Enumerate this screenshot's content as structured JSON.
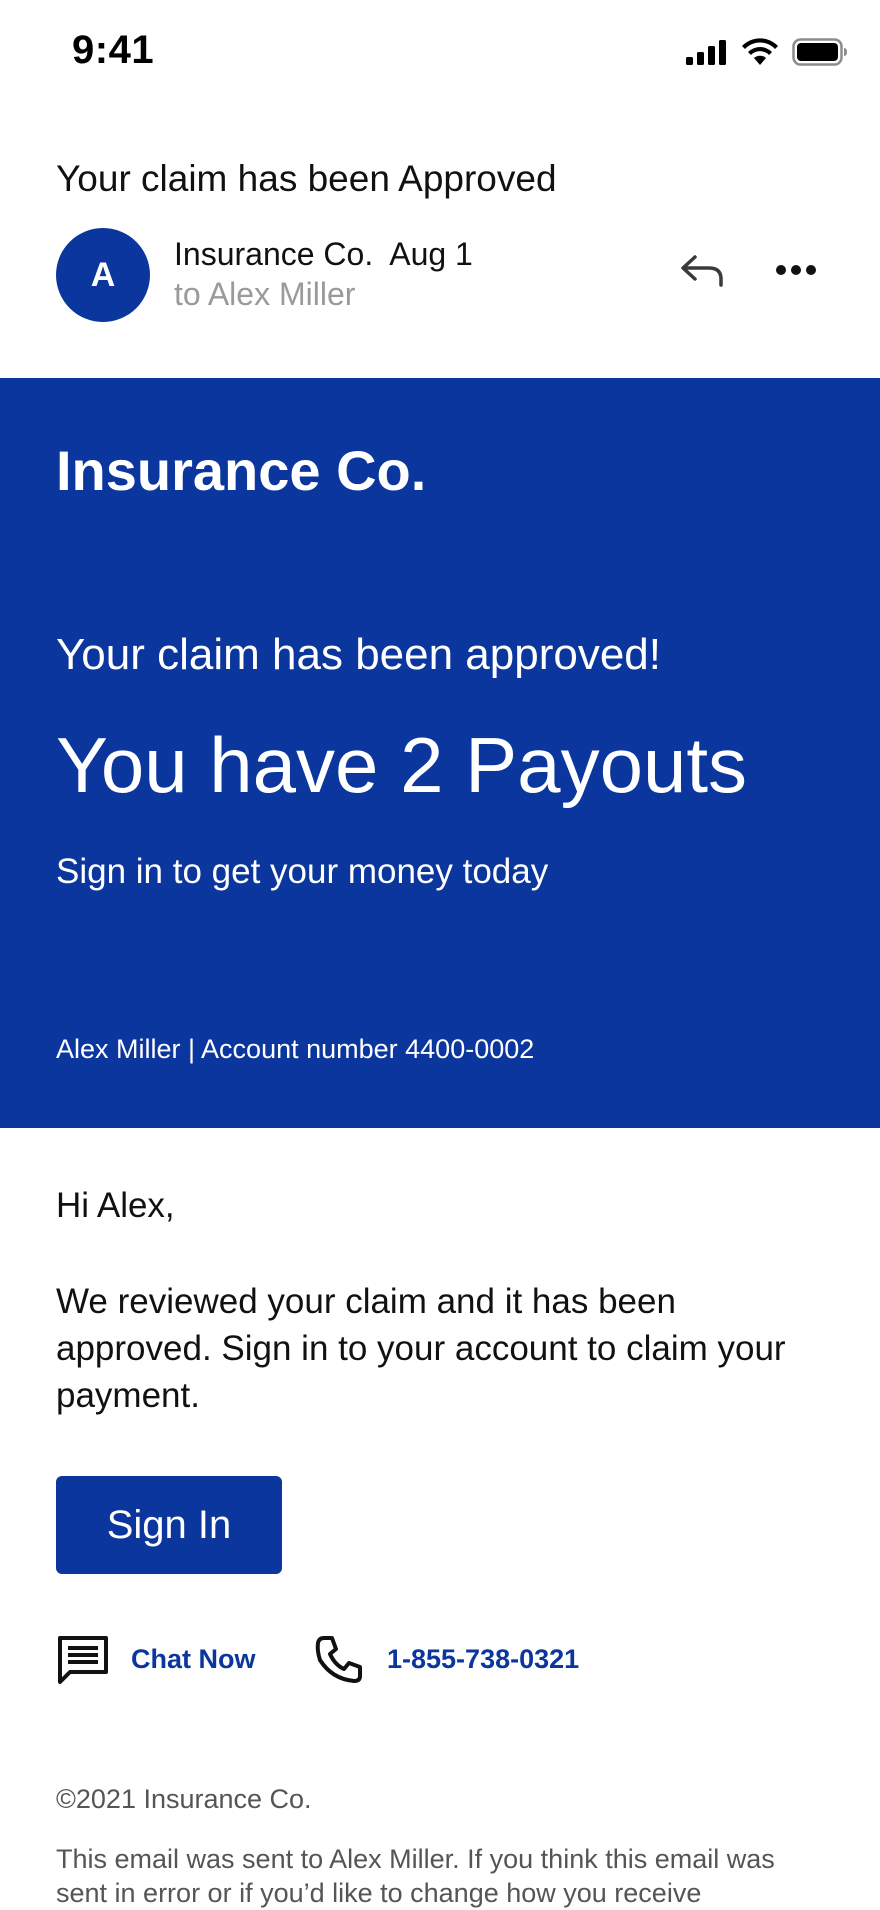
{
  "status_bar": {
    "time": "9:41",
    "icons": [
      "signal-icon",
      "wifi-icon",
      "battery-icon"
    ]
  },
  "email": {
    "subject": "Your claim has been Approved",
    "avatar_initial": "A",
    "sender": "Insurance Co.",
    "date": "Aug 1",
    "recipient": "to Alex Miller",
    "actions": [
      "reply-icon",
      "more-icon"
    ]
  },
  "hero": {
    "brand": "Insurance Co.",
    "subtitle": "Your claim has been approved!",
    "title": "You have 2 Payouts",
    "cta_text": "Sign in to get your money today",
    "account_line": "Alex Miller | Account number 4400-0002",
    "background_color": "#0a369d"
  },
  "body": {
    "greeting": "Hi Alex,",
    "message": "We reviewed your claim and it has been approved. Sign in to your account to claim your payment.",
    "signin_label": "Sign In"
  },
  "contact": {
    "chat_label": "Chat Now",
    "chat_icon": "chat-icon",
    "phone_label": "1-855-738-0321",
    "phone_icon": "phone-icon",
    "link_color": "#0a369d"
  },
  "footer": {
    "copyright": "©2021 Insurance Co.",
    "note": "This email was sent to Alex Miller. If you think this email was sent in error or if you’d like to change how you receive"
  }
}
